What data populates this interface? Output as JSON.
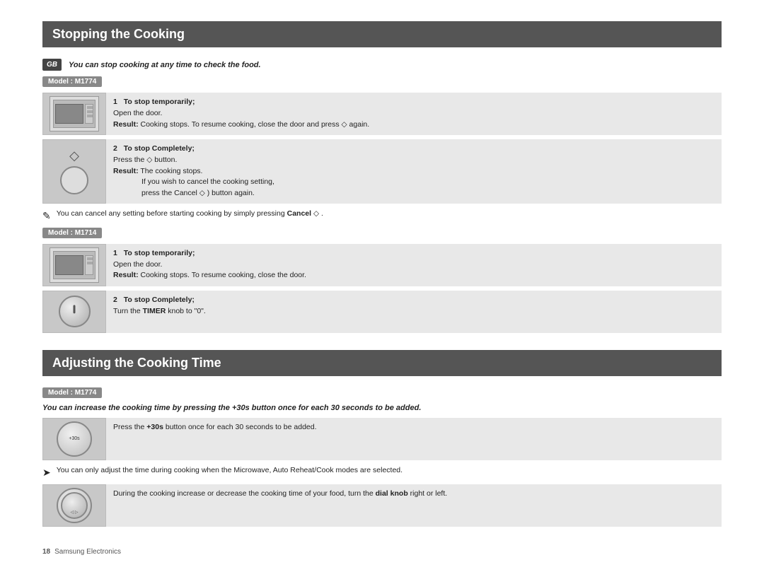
{
  "section1": {
    "title": "Stopping the Cooking",
    "intro": "You can stop cooking at any time to check the food.",
    "model1": {
      "label": "Model : M1774",
      "steps": [
        {
          "num": "1",
          "title": "To stop temporarily;",
          "lines": [
            "Open the door.",
            "Result:   Cooking stops. To resume cooking, close the door and press ◇ again."
          ]
        },
        {
          "num": "2",
          "title": "To stop Completely;",
          "lines": [
            "Press the ◇ button.",
            "Result:   The cooking stops.",
            "             If you wish to cancel the cooking setting,",
            "             press the Cancel ◇ ) button again."
          ]
        }
      ],
      "note": "You can cancel any setting before starting cooking by simply pressing Cancel ◇ ."
    },
    "model2": {
      "label": "Model : M1714",
      "steps": [
        {
          "num": "1",
          "title": "To stop temporarily;",
          "lines": [
            "Open the door.",
            "Result:   Cooking stops. To resume cooking, close the door."
          ]
        },
        {
          "num": "2",
          "title": "To stop Completely;",
          "lines": [
            "Turn the TIMER knob to \"0\"."
          ]
        }
      ]
    }
  },
  "section2": {
    "title": "Adjusting the Cooking Time",
    "model1": {
      "label": "Model : M1774",
      "intro_bold": "You can increase the cooking time by pressing the +30s button once for each 30 seconds to be added.",
      "step1_text": "Press the +30s button once for each 30 seconds to be added.",
      "note": "You can only adjust the time during cooking when the Microwave, Auto Reheat/Cook modes are selected.",
      "step2_text": "During the cooking increase or decrease the cooking time of your food, turn the dial knob right or left."
    }
  },
  "footer": {
    "page_num": "18",
    "brand": "Samsung Electronics"
  }
}
